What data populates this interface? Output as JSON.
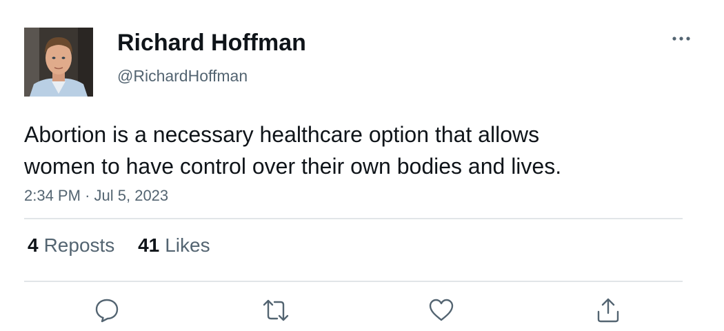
{
  "author": {
    "name": "Richard Hoffman",
    "handle": "@RichardHoffman"
  },
  "tweet": {
    "text_lines": [
      "Abortion is a necessary healthcare option that allows",
      "women to have control over their own bodies and lives."
    ],
    "time": "2:34 PM",
    "separator": "·",
    "date": "Jul 5, 2023"
  },
  "stats": {
    "reposts_count": "4",
    "reposts_label": "Reposts",
    "likes_count": "41",
    "likes_label": "Likes"
  },
  "actions": [
    "reply-icon",
    "repost-icon",
    "like-icon",
    "share-icon"
  ],
  "colors": {
    "text": "#0f1419",
    "secondary": "#536471",
    "divider": "#e1e5e8",
    "icon": "#536471"
  }
}
